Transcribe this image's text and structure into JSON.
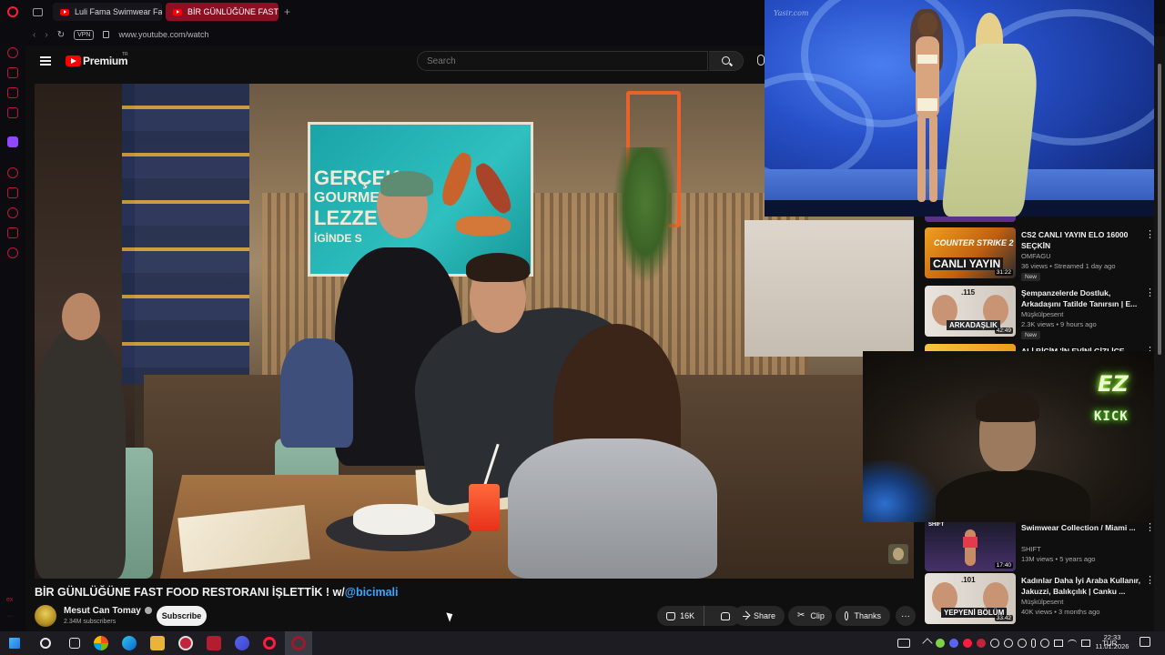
{
  "browser": {
    "tabs": [
      {
        "label": "Luli Fama Swimwear Fash"
      },
      {
        "label": "BİR GÜNLÜĞÜNE FAST"
      }
    ],
    "url": "www.youtube.com/watch",
    "vpn_label": "VPN",
    "sidebar_text": "ex"
  },
  "youtube": {
    "logo_text": "Premium",
    "logo_suffix": "TR",
    "search_placeholder": "Search"
  },
  "video": {
    "ad_words": [
      "GERÇEK",
      "GOURME",
      "LEZZE",
      "İGİNDE S"
    ],
    "title_main": "BİR GÜNLÜĞÜNE FAST FOOD RESTORANI İŞLETTİK ! w/",
    "title_mention": "@bicimali",
    "channel_name": "Mesut Can Tomay",
    "subscribers": "2.34M subscribers",
    "subscribe_label": "Subscribe",
    "like_count": "16K",
    "share_label": "Share",
    "clip_label": "Clip",
    "thanks_label": "Thanks"
  },
  "pip": {
    "watermark": "Yasir.com"
  },
  "recommendations": [
    {
      "title": "CS2 CANLI YAYIN ELO 16000 SEÇKİN",
      "channel": "OMFAGU",
      "meta": "36 views • Streamed 1 day ago",
      "badge": "New",
      "duration": "31:22",
      "thumb_top": "COUNTER STRIKE 2",
      "thumb_main": "CANLI YAYIN"
    },
    {
      "title": "Şempanzelerde Dostluk, Arkadaşını Tatilde Tanırsın | E...",
      "channel": "Müşkülpesent",
      "meta": "2.3K views • 9 hours ago",
      "badge": "New",
      "duration": "42:49",
      "thumb_num": ".115",
      "thumb_label": "ARKADAŞLIK"
    },
    {
      "title": "ALİ BİCİM 'İN EVİNİ GİZLİCE",
      "channel": "",
      "meta": "",
      "badge": "",
      "duration": ""
    },
    {
      "title": "Swimwear Collection / Miami ...",
      "channel": "SHIFT",
      "meta": "13M views • 5 years ago",
      "badge": "",
      "duration": "17:40",
      "thumb_tag": "SHIFT"
    },
    {
      "title": "Kadınlar Daha İyi Araba Kullanır, Jakuzzi, Balıkçılık | Canku ...",
      "channel": "Müşkülpesent",
      "meta": "40K views • 3 months ago",
      "badge": "",
      "duration": "33:42",
      "thumb_num": ".101",
      "thumb_label": "YEPYENİ BÖLÜM"
    }
  ],
  "webcam": {
    "logo_ez": "EZ",
    "logo_kick": "KICK"
  },
  "taskbar": {
    "language": "TUR",
    "time": "22:33",
    "date": "11.01.2026"
  }
}
